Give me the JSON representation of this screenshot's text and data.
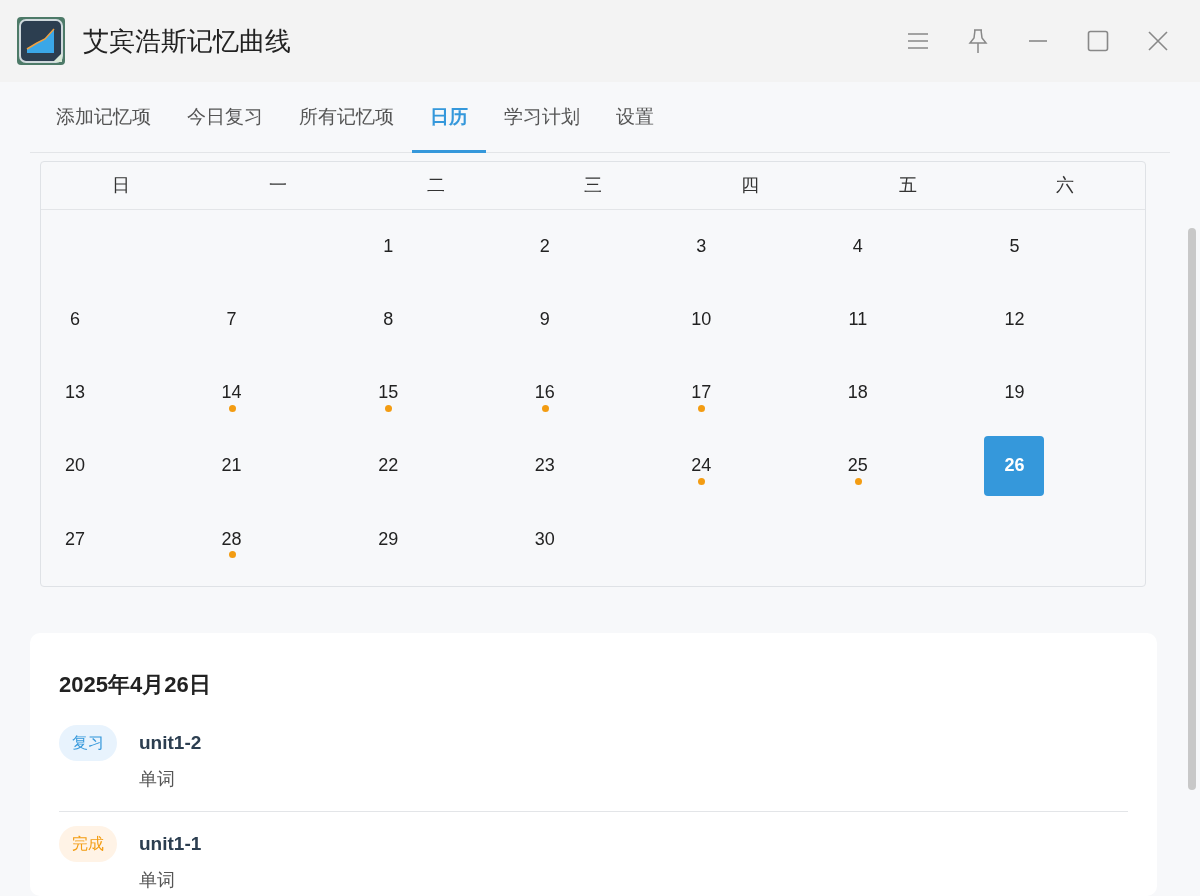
{
  "window": {
    "title": "艾宾浩斯记忆曲线"
  },
  "tabs": [
    {
      "label": "添加记忆项",
      "selected": false
    },
    {
      "label": "今日复习",
      "selected": false
    },
    {
      "label": "所有记忆项",
      "selected": false
    },
    {
      "label": "日历",
      "selected": true
    },
    {
      "label": "学习计划",
      "selected": false
    },
    {
      "label": "设置",
      "selected": false
    }
  ],
  "calendar": {
    "weekdays": [
      "日",
      "一",
      "二",
      "三",
      "四",
      "五",
      "六"
    ],
    "days": [
      {
        "kind": "blank"
      },
      {
        "kind": "blank"
      },
      {
        "day": "1",
        "has_items": false,
        "selected": false
      },
      {
        "day": "2",
        "has_items": false,
        "selected": false
      },
      {
        "day": "3",
        "has_items": false,
        "selected": false
      },
      {
        "day": "4",
        "has_items": false,
        "selected": false
      },
      {
        "day": "5",
        "has_items": false,
        "selected": false
      },
      {
        "day": "6",
        "has_items": false,
        "selected": false
      },
      {
        "day": "7",
        "has_items": false,
        "selected": false
      },
      {
        "day": "8",
        "has_items": false,
        "selected": false
      },
      {
        "day": "9",
        "has_items": false,
        "selected": false
      },
      {
        "day": "10",
        "has_items": false,
        "selected": false
      },
      {
        "day": "11",
        "has_items": false,
        "selected": false
      },
      {
        "day": "12",
        "has_items": false,
        "selected": false
      },
      {
        "day": "13",
        "has_items": false,
        "selected": false
      },
      {
        "day": "14",
        "has_items": true,
        "selected": false
      },
      {
        "day": "15",
        "has_items": true,
        "selected": false
      },
      {
        "day": "16",
        "has_items": true,
        "selected": false
      },
      {
        "day": "17",
        "has_items": true,
        "selected": false
      },
      {
        "day": "18",
        "has_items": false,
        "selected": false
      },
      {
        "day": "19",
        "has_items": false,
        "selected": false
      },
      {
        "day": "20",
        "has_items": false,
        "selected": false
      },
      {
        "day": "21",
        "has_items": false,
        "selected": false
      },
      {
        "day": "22",
        "has_items": false,
        "selected": false
      },
      {
        "day": "23",
        "has_items": false,
        "selected": false
      },
      {
        "day": "24",
        "has_items": true,
        "selected": false
      },
      {
        "day": "25",
        "has_items": true,
        "selected": false
      },
      {
        "day": "26",
        "has_items": false,
        "selected": true
      },
      {
        "day": "27",
        "has_items": false,
        "selected": false
      },
      {
        "day": "28",
        "has_items": true,
        "selected": false
      },
      {
        "day": "29",
        "has_items": false,
        "selected": false
      },
      {
        "day": "30",
        "has_items": false,
        "selected": false
      }
    ]
  },
  "day_detail": {
    "title": "2025年4月26日",
    "items": [
      {
        "tag": "复习",
        "kind": "review",
        "name": "unit1-2",
        "category": "单词"
      },
      {
        "tag": "完成",
        "kind": "done",
        "name": "unit1-1",
        "category": "单词"
      }
    ]
  }
}
